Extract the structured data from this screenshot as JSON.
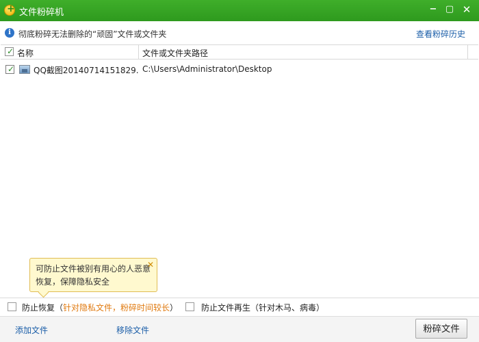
{
  "window": {
    "title": "文件粉碎机",
    "controls": {
      "minimize": "−",
      "maximize": "▢",
      "close": "✕"
    }
  },
  "infobar": {
    "icon": "i",
    "text": "彻底粉碎无法删除的“顽固”文件或文件夹",
    "history_link": "查看粉碎历史"
  },
  "list": {
    "columns": [
      "名称",
      "文件或文件夹路径"
    ],
    "rows": [
      {
        "checked": true,
        "name": "QQ截图20140714151829....",
        "path": "C:\\Users\\Administrator\\Desktop"
      }
    ]
  },
  "tooltip": {
    "text_line1": "可防止文件被别有用心的人恶意",
    "text_line2": "恢复，保障隐私安全",
    "close": "✕"
  },
  "options": {
    "prevent_recovery": {
      "label": "防止恢复（",
      "highlight": "针对隐私文件，粉碎时间较长",
      "suffix": "）",
      "checked": false
    },
    "prevent_regen": {
      "label": "防止文件再生（针对木马、病毒）",
      "checked": false
    }
  },
  "footer": {
    "add_label": "添加文件",
    "remove_label": "移除文件",
    "shred_label": "粉碎文件"
  }
}
